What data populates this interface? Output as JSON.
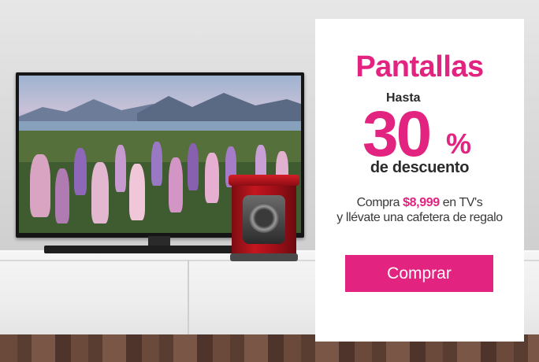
{
  "promo": {
    "title": "Pantallas",
    "prefix": "Hasta",
    "discount_number": "30",
    "discount_symbol": "%",
    "discount_label": "de descuento",
    "offer_before": "Compra ",
    "offer_price": "$8,999",
    "offer_after": " en TV's",
    "offer_line2": "y llévate una cafetera de regalo",
    "cta_label": "Comprar"
  },
  "colors": {
    "accent": "#e2237f",
    "panel_bg": "#ffffff",
    "text_dark": "#2b2b2b"
  }
}
